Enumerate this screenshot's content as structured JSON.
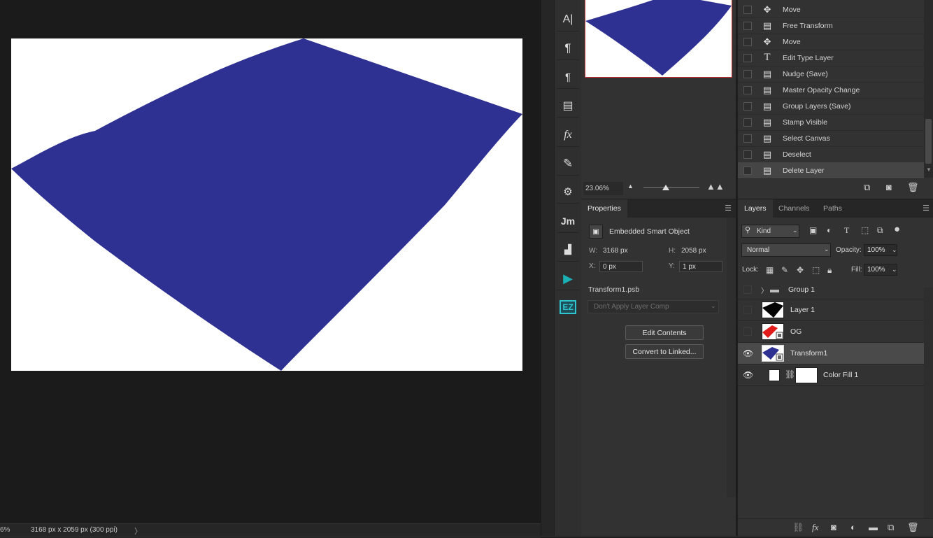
{
  "status_bar": {
    "zoom_fragment": "6%",
    "document_info": "3168 px x 2059 px (300 ppi)",
    "expand_arrow": "〉"
  },
  "tools_panel": {
    "items": [
      {
        "name": "character-tool",
        "glyph": "A|"
      },
      {
        "name": "paragraph-tool",
        "glyph": "¶"
      },
      {
        "name": "paragraph-styles-tool",
        "glyph": "¶"
      },
      {
        "name": "notes-tool",
        "glyph": "▤"
      },
      {
        "name": "styles-fx-tool",
        "glyph": "fx"
      },
      {
        "name": "brush-tool",
        "glyph": "✎"
      },
      {
        "name": "adjustments-tool",
        "glyph": "⚙"
      },
      {
        "name": "jm-plugin",
        "glyph": "Jm"
      },
      {
        "name": "histogram-tool",
        "glyph": "▟"
      },
      {
        "name": "actions-play",
        "glyph": "▶"
      },
      {
        "name": "ez-plugin",
        "glyph": "EZ"
      }
    ]
  },
  "navigator": {
    "zoom_value": "23.06%"
  },
  "history": {
    "items": [
      {
        "icon": "move-icon",
        "glyph": "✥",
        "label": "Move"
      },
      {
        "icon": "document-icon",
        "glyph": "▤",
        "label": "Free Transform"
      },
      {
        "icon": "move-icon",
        "glyph": "✥",
        "label": "Move"
      },
      {
        "icon": "type-icon",
        "glyph": "T",
        "label": "Edit Type Layer"
      },
      {
        "icon": "document-icon",
        "glyph": "▤",
        "label": "Nudge (Save)"
      },
      {
        "icon": "document-icon",
        "glyph": "▤",
        "label": "Master Opacity Change"
      },
      {
        "icon": "document-icon",
        "glyph": "▤",
        "label": "Group Layers (Save)"
      },
      {
        "icon": "document-icon",
        "glyph": "▤",
        "label": "Stamp Visible"
      },
      {
        "icon": "document-icon",
        "glyph": "▤",
        "label": "Select Canvas"
      },
      {
        "icon": "document-icon",
        "glyph": "▤",
        "label": "Deselect"
      },
      {
        "icon": "document-icon",
        "glyph": "▤",
        "label": "Delete Layer"
      }
    ],
    "active_index": 10
  },
  "properties": {
    "tab": "Properties",
    "type_label": "Embedded Smart Object",
    "w_label": "W:",
    "w_value": "3168 px",
    "h_label": "H:",
    "h_value": "2058 px",
    "x_label": "X:",
    "x_value": "0 px",
    "y_label": "Y:",
    "y_value": "1 px",
    "filename": "Transform1.psb",
    "layer_comp": "Don't Apply Layer Comp",
    "edit_contents_label": "Edit Contents",
    "convert_linked_label": "Convert to Linked..."
  },
  "layers": {
    "tabs": [
      "Layers",
      "Channels",
      "Paths"
    ],
    "kind_label": "Kind",
    "blend_mode": "Normal",
    "opacity_label": "Opacity:",
    "opacity_value": "100%",
    "lock_label": "Lock:",
    "fill_label": "Fill:",
    "fill_value": "100%",
    "rows": [
      {
        "name": "Group 1",
        "visible": false,
        "type": "group"
      },
      {
        "name": "Layer 1",
        "visible": false,
        "type": "pixel"
      },
      {
        "name": "OG",
        "visible": false,
        "type": "smart"
      },
      {
        "name": "Transform1",
        "visible": true,
        "type": "smart",
        "selected": true
      },
      {
        "name": "Color Fill 1",
        "visible": true,
        "type": "fill"
      }
    ]
  },
  "colors": {
    "shape_blue": "#2e3192",
    "accent_red": "#c8312e",
    "panel_bg": "#323232",
    "canvas_bg": "#1b1b1b"
  }
}
